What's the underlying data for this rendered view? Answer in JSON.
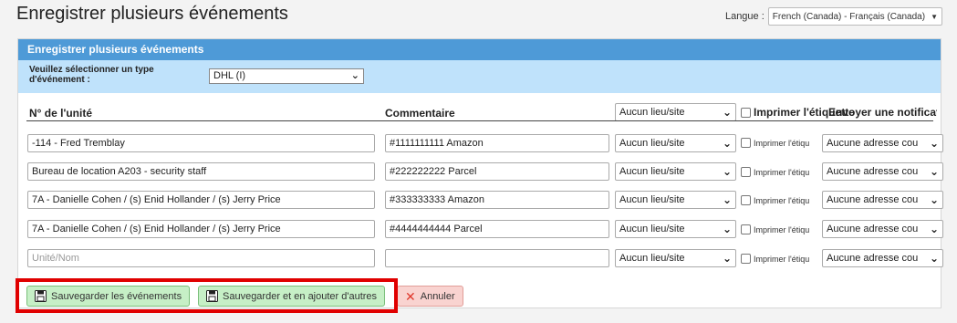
{
  "page": {
    "title": "Enregistrer plusieurs événements",
    "language_label": "Langue :",
    "language_value": "French (Canada) - Français (Canada)"
  },
  "panel": {
    "header": "Enregistrer plusieurs événements",
    "type_label": "Veuillez sélectionner un type d'événement :",
    "type_value": "DHL (I)"
  },
  "columns": {
    "unit": "N° de l'unité",
    "comment": "Commentaire",
    "location_value": "Aucun lieu/site",
    "print_label": "Imprimer l'étiquette",
    "notify_label": "Envoyer une notification"
  },
  "rows": [
    {
      "unit": "-114 - Fred Tremblay",
      "comment": "#1111111111 Amazon",
      "location": "Aucun lieu/site",
      "print": "Imprimer l'étiqu",
      "notify": "Aucune adresse cou"
    },
    {
      "unit": "Bureau de location A203 - security staff",
      "comment": "#222222222 Parcel",
      "location": "Aucun lieu/site",
      "print": "Imprimer l'étiqu",
      "notify": "Aucune adresse cou"
    },
    {
      "unit": "7A - Danielle Cohen / (s) Enid Hollander / (s) Jerry Price",
      "comment": "#333333333 Amazon",
      "location": "Aucun lieu/site",
      "print": "Imprimer l'étiqu",
      "notify": "Aucune adresse cou"
    },
    {
      "unit": "7A - Danielle Cohen / (s) Enid Hollander / (s) Jerry Price",
      "comment": "#4444444444 Parcel",
      "location": "Aucun lieu/site",
      "print": "Imprimer l'étiqu",
      "notify": "Aucune adresse cou"
    },
    {
      "unit_placeholder": "Unité/Nom",
      "comment": "",
      "location": "Aucun lieu/site",
      "print": "Imprimer l'étiqu",
      "notify": "Aucune adresse cou"
    }
  ],
  "buttons": {
    "save": "Sauvegarder les événements",
    "save_add": "Sauvegarder et en ajouter d'autres",
    "cancel": "Annuler"
  },
  "colors": {
    "header_blue": "#4e9ad7",
    "type_bar": "#bfe2fb",
    "highlight": "#e00000"
  }
}
